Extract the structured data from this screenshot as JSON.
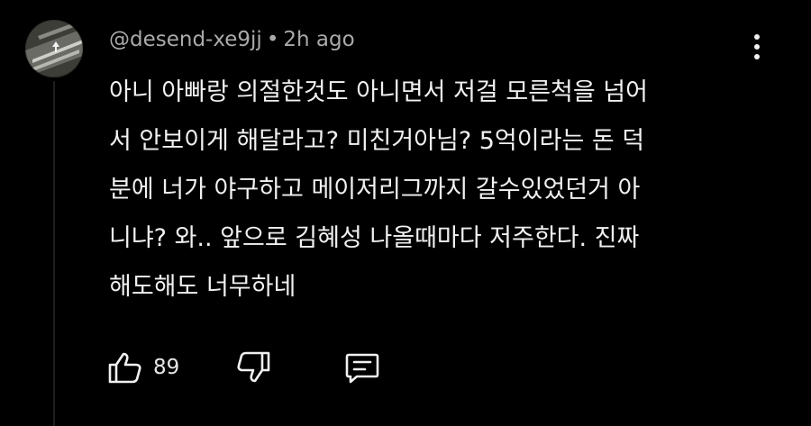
{
  "comment": {
    "author": "@desend-xe9jj",
    "separator": "•",
    "time": "2h ago",
    "text": "아니 아빠랑 의절한것도 아니면서 저걸 모른척을 넘어\n서 안보이게 해달라고? 미친거아님? 5억이라는 돈 덕\n분에 너가 야구하고 메이저리그까지 갈수있었던거 아\n니냐? 와.. 앞으로 김혜성 나올때마다 저주한다. 진짜\n해도해도 너무하네",
    "likes": "89"
  },
  "icons": {
    "avatar": "avatar-image",
    "menu": "more-vert-icon",
    "like": "thumbs-up-icon",
    "dislike": "thumbs-down-icon",
    "reply": "comment-reply-icon"
  },
  "colors": {
    "background": "#000000",
    "text": "#f1f1f1",
    "meta": "#aaaaaa"
  }
}
